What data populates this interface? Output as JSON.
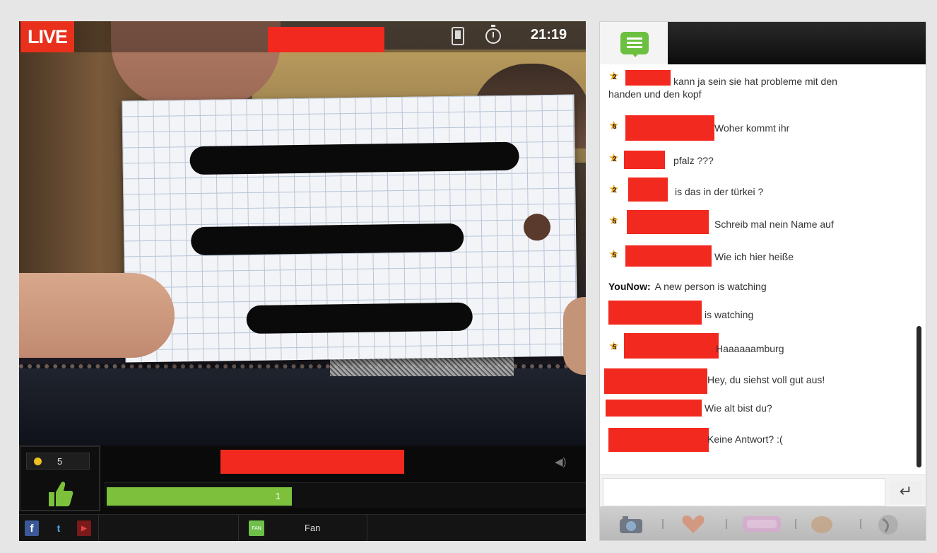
{
  "video": {
    "live_label": "LIVE",
    "time": "21:19",
    "coins": "5",
    "like_progress_value": "1",
    "fan_label": "Fan",
    "fan_badge": "FAN",
    "social": [
      "f",
      "t",
      "▶"
    ]
  },
  "chat": {
    "messages": [
      {
        "level": "2",
        "text": "kann ja  sein sie  hat  probleme  mit  den",
        "text2": "handen und  den kopf"
      },
      {
        "level": "5",
        "text": "Woher kommt ihr"
      },
      {
        "level": "2",
        "text": "pfalz ???"
      },
      {
        "level": "2",
        "text": "is das in der türkei ?"
      },
      {
        "level": "5",
        "text": "Schreib mal nein Name auf"
      },
      {
        "level": "5",
        "text": "Wie ich hier heiße"
      },
      {
        "sender": "YouNow:",
        "text": "A new person is watching"
      },
      {
        "text": "is watching"
      },
      {
        "level": "5",
        "text": "Haaaaaamburg"
      },
      {
        "text": "Hey, du siehst voll gut aus!"
      },
      {
        "text": "Wie alt bist du?"
      },
      {
        "text": "Keine Antwort? :("
      }
    ],
    "input_placeholder": "",
    "send_icon": "↵"
  },
  "colors": {
    "live_red": "#e8301c",
    "redaction": "#f2291f",
    "accent_green": "#7cc03c"
  },
  "icons": [
    "phone-icon",
    "timer-icon",
    "coin-icon",
    "thumbs-up-icon",
    "volume-icon",
    "chat-bubble-icon",
    "camera-icon",
    "heart-gift-icon",
    "sticker-gift-icon",
    "hand-gift-icon",
    "globe-gift-icon"
  ]
}
